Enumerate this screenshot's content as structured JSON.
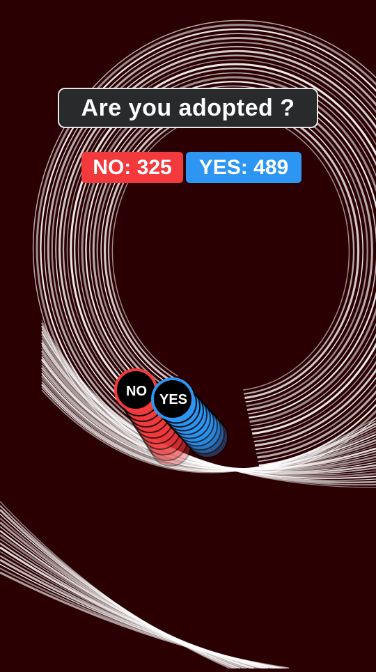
{
  "question": "Are you adopted ?",
  "scores": {
    "no": {
      "label": "NO:",
      "value": "325"
    },
    "yes": {
      "label": "YES:",
      "value": "489"
    }
  },
  "balls": {
    "no": {
      "label": "NO"
    },
    "yes": {
      "label": "YES"
    }
  },
  "colors": {
    "background": "#2a0002",
    "spiral": "#ffffff",
    "no": "#f23a3d",
    "yes": "#2d95f2",
    "question_box": "#292a2c"
  }
}
